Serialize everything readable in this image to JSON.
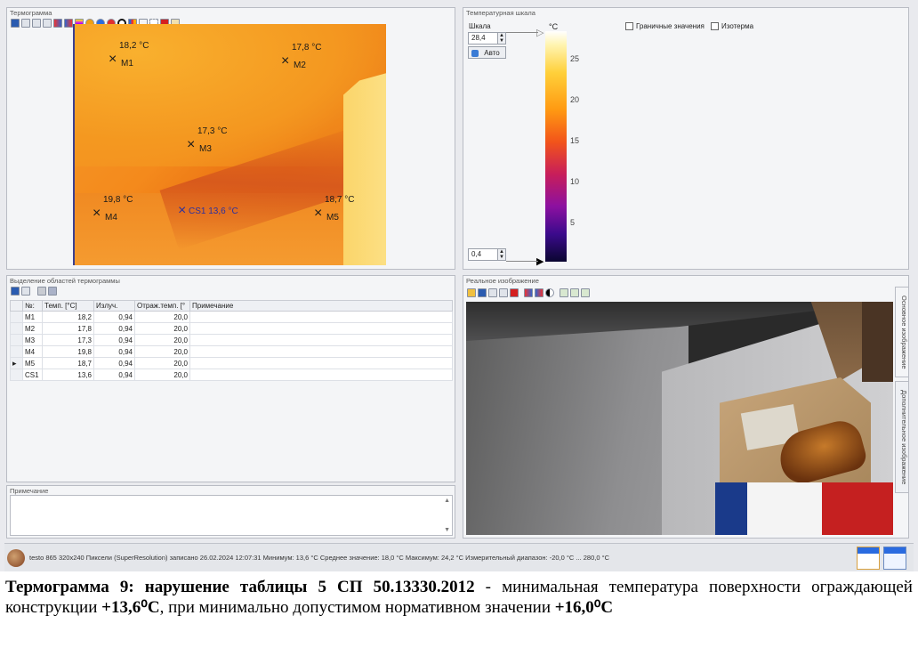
{
  "thermogram": {
    "title": "Термограмма",
    "markers": [
      {
        "id": "M1",
        "temp": "18,2 °C"
      },
      {
        "id": "M2",
        "temp": "17,8 °C"
      },
      {
        "id": "M3",
        "temp": "17,3 °C"
      },
      {
        "id": "M4",
        "temp": "19,8 °C"
      },
      {
        "id": "M5",
        "temp": "18,7 °C"
      },
      {
        "id": "CS1",
        "temp": "CS1 13,6 °C"
      }
    ]
  },
  "scale": {
    "title": "Температурная шкала",
    "scale_label": "Шкала",
    "max_value": "28,4",
    "min_value": "0,4",
    "auto_label": "Авто",
    "unit": "°C",
    "boundary_label": "Граничные значения",
    "isotherm_label": "Изотерма",
    "ticks": [
      "25",
      "20",
      "15",
      "10",
      "5"
    ]
  },
  "regions": {
    "title": "Выделение областей термограммы",
    "columns": [
      "№:",
      "Темп. [°C]",
      "Излуч.",
      "Отраж.темп. [°",
      "Примечание"
    ],
    "rows": [
      {
        "n": "M1",
        "temp": "18,2",
        "emis": "0,94",
        "refl": "20,0",
        "note": ""
      },
      {
        "n": "M2",
        "temp": "17,8",
        "emis": "0,94",
        "refl": "20,0",
        "note": ""
      },
      {
        "n": "M3",
        "temp": "17,3",
        "emis": "0,94",
        "refl": "20,0",
        "note": ""
      },
      {
        "n": "M4",
        "temp": "19,8",
        "emis": "0,94",
        "refl": "20,0",
        "note": ""
      },
      {
        "n": "M5",
        "temp": "18,7",
        "emis": "0,94",
        "refl": "20,0",
        "note": ""
      },
      {
        "n": "CS1",
        "temp": "13,6",
        "emis": "0,94",
        "refl": "20,0",
        "note": ""
      }
    ],
    "selected_row_marker": "▸"
  },
  "note": {
    "title": "Примечание"
  },
  "photo": {
    "title": "Реальное изображение",
    "tab_main": "Основное изображение",
    "tab_extra": "Дополнительное изображение"
  },
  "status": {
    "text": "testo 865 320x240 Пиксели (SuperResolution) записано 26.02.2024 12:07:31 Минимум: 13,6 °C Среднее значение: 18,0 °C Максимум: 24,2 °C Измерительный диапазон: -20,0 °C ... 280,0 °C"
  },
  "caption": {
    "bold_part": "Термограмма 9: нарушение таблицы 5 СП 50.13330.2012",
    "text_part": " - минимальная температура поверхности ограждающей конструкции ",
    "value_1": "+13,6⁰С",
    "text_part_2": ", при минимально допустимом нормативном значении ",
    "value_2": "+16,0⁰С"
  },
  "colors": {
    "accent_blue": "#3b3f8f",
    "window_bg": "#e9eaee",
    "delete_red": "#d42020"
  }
}
